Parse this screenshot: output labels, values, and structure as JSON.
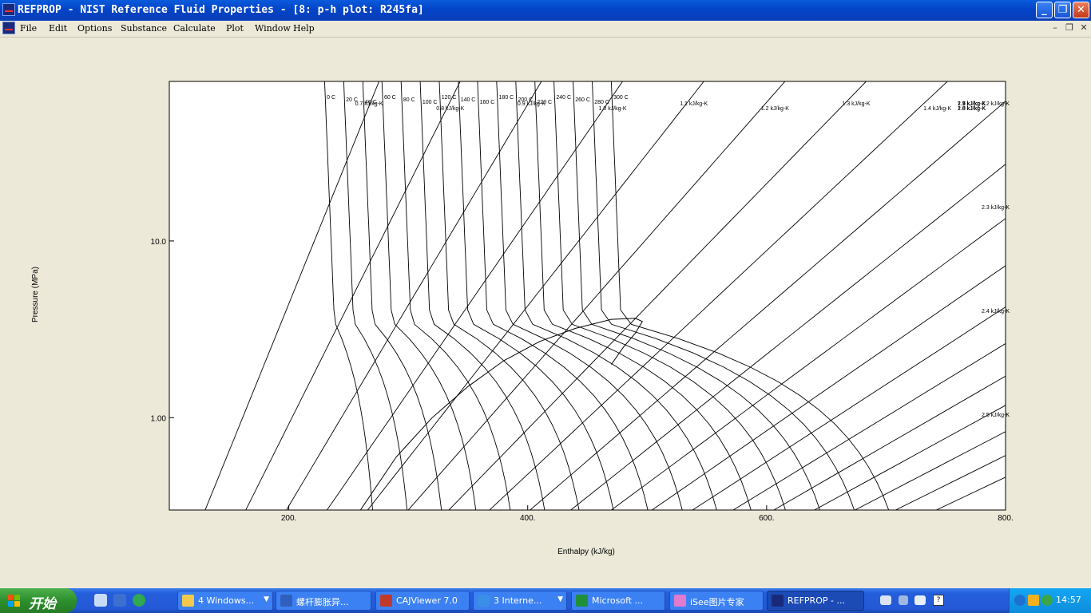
{
  "window": {
    "title": "REFPROP - NIST Reference Fluid Properties - [8: p-h plot: R245fa]",
    "minimize_glyph": "_",
    "restore_glyph": "❐",
    "close_glyph": "✕"
  },
  "menu": {
    "items": [
      "File",
      "Edit",
      "Options",
      "Substance",
      "Calculate",
      "Plot",
      "Window",
      "Help"
    ],
    "mdi_minimize": "–",
    "mdi_restore": "❐",
    "mdi_close": "✕"
  },
  "chart_data": {
    "type": "line",
    "title": "",
    "xlabel": "Enthalpy (kJ/kg)",
    "ylabel": "Pressure (MPa)",
    "xlim": [
      100,
      800
    ],
    "ylim": [
      0.3,
      80
    ],
    "y_scale": "log",
    "grid": false,
    "x_ticks": [
      200,
      400,
      600,
      800
    ],
    "x_tick_labels": [
      "200.",
      "400.",
      "600.",
      "800."
    ],
    "y_ticks": [
      1.0,
      10.0
    ],
    "y_tick_labels": [
      "1.00",
      "10.0"
    ],
    "saturation_dome": {
      "h": [
        260,
        290,
        320,
        350,
        380,
        410,
        440,
        470,
        490,
        496,
        490,
        480,
        470
      ],
      "p": [
        0.3,
        0.6,
        1.0,
        1.5,
        2.1,
        2.7,
        3.2,
        3.6,
        3.65,
        3.5,
        3.0,
        2.5,
        2.0
      ]
    },
    "isotherm_labels": [
      "0 C",
      "20 C",
      "40 C",
      "60 C",
      "80 C",
      "100 C",
      "120 C",
      "140 C",
      "160 C",
      "180 C",
      "200 C",
      "220 C",
      "240 C",
      "260 C",
      "280 C",
      "300 C"
    ],
    "isentrope_labels": [
      "0.7 kJ/kg-K",
      "0.8 kJ/kg-K",
      "0.9 kJ/kg-K",
      "1.0 kJ/kg-K",
      "1.1 kJ/kg-K",
      "1.2 kJ/kg-K",
      "1.3 kJ/kg-K",
      "1.4 kJ/kg-K",
      "1.5 kJ/kg-K",
      "1.6 kJ/kg-K",
      "1.7 kJ/kg-K",
      "1.8 kJ/kg-K",
      "1.9 kJ/kg-K",
      "2.0 kJ/kg-K",
      "2.1 kJ/kg-K",
      "2.2 kJ/kg-K",
      "2.3 kJ/kg-K",
      "2.4 kJ/kg-K",
      "2.5 kJ/kg-K"
    ]
  },
  "taskbar": {
    "start_label": "开始",
    "tasks": [
      {
        "label": "4 Windows...",
        "icon_color": "#f2c94c",
        "has_arrow": true
      },
      {
        "label": "螺杆膨胀异...",
        "icon_color": "#2f5fbf",
        "has_arrow": false
      },
      {
        "label": "CAJViewer 7.0",
        "icon_color": "#c0392b",
        "has_arrow": false
      },
      {
        "label": "3 Interne...",
        "icon_color": "#3a8ee6",
        "has_arrow": true
      },
      {
        "label": "Microsoft ...",
        "icon_color": "#1f8f3a",
        "has_arrow": false
      },
      {
        "label": "iSee图片专家",
        "icon_color": "#e07bd0",
        "has_arrow": false
      },
      {
        "label": "REFPROP - ...",
        "icon_color": "#1a2a7a",
        "has_arrow": false
      }
    ],
    "clock": "14:57",
    "lang_indicator": "?"
  }
}
